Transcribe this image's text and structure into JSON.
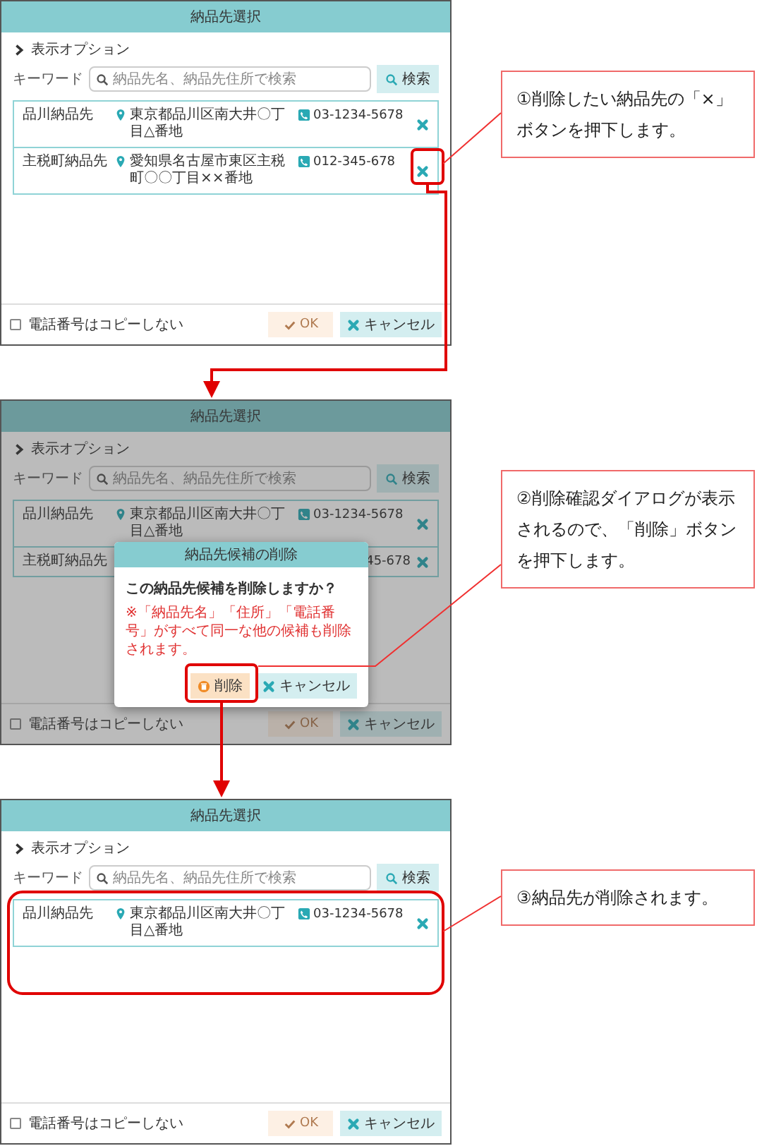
{
  "steps": [
    {
      "screen": {
        "title": "納品先選択",
        "options_label": "表示オプション",
        "keyword_label": "キーワード",
        "search_placeholder": "納品先名、納品先住所で検索",
        "search_button": "検索",
        "rows": [
          {
            "kind": "full",
            "name": "品川納品先",
            "address": "東京都品川区南大井〇丁目△番地",
            "phone": "03-1234-5678"
          },
          {
            "kind": "full",
            "name": "主税町納品先",
            "address": "愛知県名古屋市東区主税町〇〇丁目××番地",
            "phone": "012-345-678"
          }
        ],
        "copy_checkbox": {
          "label": "電話番号はコピーしない",
          "checked": false
        },
        "ok_button": {
          "label": "OK",
          "disabled": true
        },
        "cancel_button": "キャンセル",
        "dimmed": false
      },
      "callout": "①削除したい納品先の「×」ボタンを押下します。"
    },
    {
      "screen": {
        "title": "納品先選択",
        "options_label": "表示オプション",
        "keyword_label": "キーワード",
        "search_placeholder": "納品先名、納品先住所で検索",
        "search_button": "検索",
        "rows": [
          {
            "kind": "full",
            "name": "品川納品先",
            "address": "東京都品川区南大井〇丁目△番地",
            "phone": "03-1234-5678"
          },
          {
            "kind": "covered",
            "name": "主税町納品先",
            "phone": "45-678"
          }
        ],
        "copy_checkbox": {
          "label": "電話番号はコピーしない",
          "checked": false
        },
        "ok_button": {
          "label": "OK",
          "disabled": true
        },
        "cancel_button": "キャンセル",
        "dimmed": true,
        "dialog": {
          "title": "納品先候補の削除",
          "question": "この納品先候補を削除しますか？",
          "note": "※「納品先名」「住所」「電話番号」がすべて同一な他の候補も削除されます。",
          "delete_button": "削除",
          "cancel_button": "キャンセル"
        }
      },
      "callout": "②削除確認ダイアログが表示されるので、「削除」ボタンを押下します。"
    },
    {
      "screen": {
        "title": "納品先選択",
        "options_label": "表示オプション",
        "keyword_label": "キーワード",
        "search_placeholder": "納品先名、納品先住所で検索",
        "search_button": "検索",
        "rows": [
          {
            "kind": "full",
            "name": "品川納品先",
            "address": "東京都品川区南大井〇丁目△番地",
            "phone": "03-1234-5678"
          }
        ],
        "copy_checkbox": {
          "label": "電話番号はコピーしない",
          "checked": false
        },
        "ok_button": {
          "label": "OK",
          "disabled": true
        },
        "cancel_button": "キャンセル",
        "dimmed": false
      },
      "callout": "③納品先が削除されます。"
    }
  ]
}
